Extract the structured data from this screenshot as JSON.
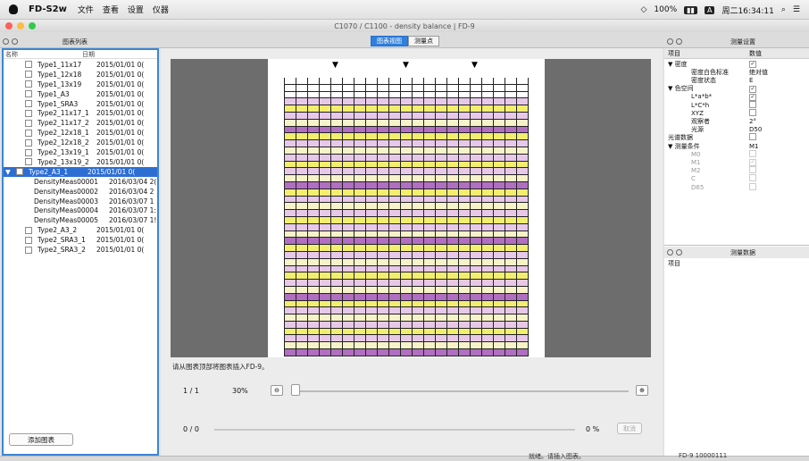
{
  "menubar": {
    "app": "FD-S2w",
    "items": [
      "文件",
      "查看",
      "设置",
      "仪器"
    ],
    "battery": "100%",
    "day_time": "周二16:34:11"
  },
  "window": {
    "title": "C1070 / C1100 - density balance | FD-9"
  },
  "tabs": {
    "chart": "图表视图",
    "measure": "测量点"
  },
  "left": {
    "header": "图表列表",
    "col_name": "名称",
    "col_date": "日期",
    "add_button": "添加图表",
    "rows": [
      {
        "name": "Type1_11x17",
        "date": "2015/01/01 0(",
        "cb": true
      },
      {
        "name": "Type1_12x18",
        "date": "2015/01/01 0(",
        "cb": true
      },
      {
        "name": "Type1_13x19",
        "date": "2015/01/01 0(",
        "cb": true
      },
      {
        "name": "Type1_A3",
        "date": "2015/01/01 0(",
        "cb": true
      },
      {
        "name": "Type1_SRA3",
        "date": "2015/01/01 0(",
        "cb": true
      },
      {
        "name": "Type2_11x17_1",
        "date": "2015/01/01 0(",
        "cb": true
      },
      {
        "name": "Type2_11x17_2",
        "date": "2015/01/01 0(",
        "cb": true
      },
      {
        "name": "Type2_12x18_1",
        "date": "2015/01/01 0(",
        "cb": true
      },
      {
        "name": "Type2_12x18_2",
        "date": "2015/01/01 0(",
        "cb": true
      },
      {
        "name": "Type2_13x19_1",
        "date": "2015/01/01 0(",
        "cb": true
      },
      {
        "name": "Type2_13x19_2",
        "date": "2015/01/01 0(",
        "cb": true
      },
      {
        "name": "Type2_A3_1",
        "date": "2015/01/01 0(",
        "cb": true,
        "selected": true
      },
      {
        "name": "DensityMeas00001",
        "date": "2016/03/04 2(",
        "cb": false
      },
      {
        "name": "DensityMeas00002",
        "date": "2016/03/04 2",
        "cb": false
      },
      {
        "name": "DensityMeas00003",
        "date": "2016/03/07 1",
        "cb": false
      },
      {
        "name": "DensityMeas00004",
        "date": "2016/03/07 1:",
        "cb": false
      },
      {
        "name": "DensityMeas00005",
        "date": "2016/03/07 1!",
        "cb": false
      },
      {
        "name": "Type2_A3_2",
        "date": "2015/01/01 0(",
        "cb": true
      },
      {
        "name": "Type2_SRA3_1",
        "date": "2015/01/01 0(",
        "cb": true
      },
      {
        "name": "Type2_SRA3_2",
        "date": "2015/01/01 0(",
        "cb": true
      }
    ]
  },
  "center": {
    "message": "请从图表顶部将图表插入FD-9。",
    "page": "1 / 1",
    "zoom": "30%",
    "progress": "0 / 0",
    "percent": "0 %",
    "cancel": "取消"
  },
  "right": {
    "header1": "测量设置",
    "col_item": "项目",
    "col_value": "数值",
    "rows": [
      {
        "k": "▼ 密度",
        "v": "✓",
        "chk": true
      },
      {
        "k": "密度白色标准",
        "v": "绝对值",
        "ind": 2
      },
      {
        "k": "密度状态",
        "v": "E",
        "ind": 2
      },
      {
        "k": "▼ 色空间",
        "v": "✓",
        "chk": true
      },
      {
        "k": "L*a*b*",
        "v": "✓",
        "chk": true,
        "ind": 2
      },
      {
        "k": "L*C*h",
        "v": "",
        "chk": true,
        "ind": 2
      },
      {
        "k": "XYZ",
        "v": "",
        "chk": true,
        "ind": 2
      },
      {
        "k": "观察者",
        "v": "2°",
        "ind": 2
      },
      {
        "k": "光源",
        "v": "D50",
        "ind": 2
      },
      {
        "k": "光谱数据",
        "v": "",
        "chk": true
      },
      {
        "k": "▼ 测量条件",
        "v": "M1"
      },
      {
        "k": "M0",
        "v": "",
        "chk": true,
        "ind": 2,
        "dim": true
      },
      {
        "k": "M1",
        "v": "✓",
        "chk": true,
        "ind": 2,
        "dim": true
      },
      {
        "k": "M2",
        "v": "",
        "chk": true,
        "ind": 2,
        "dim": true
      },
      {
        "k": "C",
        "v": "",
        "chk": true,
        "ind": 2,
        "dim": true
      },
      {
        "k": "D65",
        "v": "",
        "chk": true,
        "ind": 2,
        "dim": true
      }
    ],
    "header2": "测量数据",
    "col_item2": "项目"
  },
  "status": {
    "left": "就绪。请插入图表。",
    "right": "FD-9 10000111"
  },
  "colors": {
    "accent": "#2d6ed3",
    "magenta": "#b06fc0",
    "pink": "#e7c8e9",
    "yellow": "#f2ee6e",
    "pale_yellow": "#f6f3c8"
  }
}
